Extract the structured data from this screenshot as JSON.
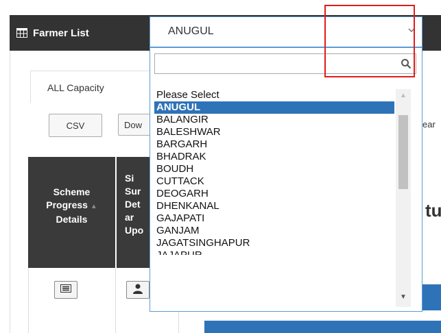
{
  "header": {
    "title": "Farmer List"
  },
  "tabs": {
    "active_label": "ALL Capacity"
  },
  "toolbar": {
    "csv_label": "CSV",
    "download_label": "Dow",
    "clipped_right": "ear"
  },
  "table": {
    "col1_line1": "Scheme",
    "col1_line2": "Progress",
    "col1_line3": "Details",
    "col2_lines": [
      "Si",
      "Sur",
      "Det",
      "ar",
      "Upo"
    ],
    "big_text": "tu"
  },
  "select": {
    "value": "ANUGUL",
    "search_placeholder": "",
    "options": [
      "Please Select",
      "ANUGUL",
      "BALANGIR",
      "BALESHWAR",
      "BARGARH",
      "BHADRAK",
      "BOUDH",
      "CUTTACK",
      "DEOGARH",
      "DHENKANAL",
      "GAJAPATI",
      "GANJAM",
      "JAGATSINGHAPUR",
      "JAJAPUR"
    ]
  },
  "colors": {
    "header_bg": "#333333",
    "accent": "#2e73b8",
    "annotation": "#e11b1b"
  }
}
